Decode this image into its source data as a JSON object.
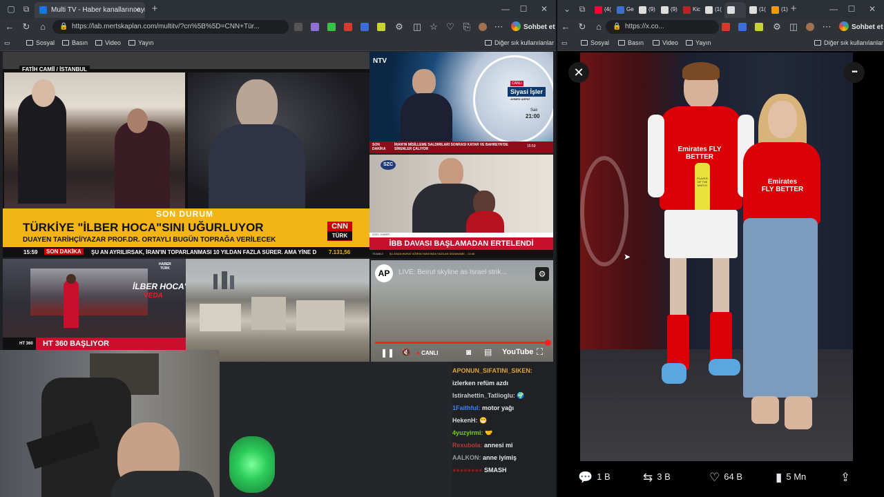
{
  "left_window": {
    "tab": {
      "title": "Multi TV - Haber kanallarını aynı a",
      "close": "✕"
    },
    "new_tab": "+",
    "controls": {
      "min": "—",
      "max": "☐",
      "close": "✕"
    },
    "url": "https://lab.mertskaplan.com/multitv/?cn%5B%5D=CNN+Tür...",
    "sohbet": "Sohbet et",
    "bookmarks": [
      "Sosyal",
      "Basın",
      "Video",
      "Yayın"
    ],
    "other_bookmarks": "Diğer sık kullanılanlar"
  },
  "tiles": {
    "cnn": {
      "location": "FATİH CAMİİ / İSTANBUL",
      "banner_tag": "SON DURUM",
      "headline": "TÜRKİYE \"İLBER HOCA\"SINI UĞURLUYOR",
      "subline": "DUAYEN TARİHÇİ/YAZAR PROF.DR. ORTAYLI BUGÜN TOPRAĞA VERİLECEK",
      "time": "15:59",
      "son_dakika": "SON DAKİKA",
      "ticker": "ŞU AN AYRILIRSAK, İRAN'IN TOPARLANMASI 10 YILDAN FAZLA SÜRER. AMA YİNE D",
      "index": "7.131,56",
      "logo_top": "CNN",
      "logo_bottom": "TÜRK"
    },
    "ntv": {
      "logo": "NTV",
      "program": "Siyasi İşler",
      "host": "AHMED ARPAT",
      "day": "Salı",
      "time": "21:00",
      "live": "CANLI",
      "son": "SON DAKİKA",
      "ticker": "İRAN'IN MİSİLLEME SALDIRILARI SONRASI KATAR VE BAHREYN'DE SİRENLER ÇALIYOR",
      "clock": "15:59"
    },
    "szc": {
      "logo": "SZC",
      "headline": "İBB DAVASI BAŞLAMADAN ERTELENDİ",
      "tag": "ÖZEL HABER",
      "ticker": "ŞU ANDA MURAT AĞIRIN HAKKINDA YAZILAN İDDİANAME... 13:45",
      "index": "73.645.2"
    },
    "haberturk": {
      "logo_top": "HABER",
      "logo_bottom": "TÜRK",
      "banner": "İLBER HOCA'YA",
      "banner2": "VEDA",
      "bottom": "HT 360 BAŞLIYOR",
      "tag": "HT 360"
    },
    "ap": {
      "logo": "AP",
      "title": "LIVE: Beirut skyline as Israel strik...",
      "live": "CANLI",
      "youtube": "YouTube",
      "progress": 1.0
    }
  },
  "chat": [
    {
      "user": "APONUN_SIFATINI_SIKEN:",
      "msg": "izlerken refüm azdı",
      "color": "#e0a23a"
    },
    {
      "user": "Istirahettin_Tatlioglu:",
      "msg": "🌍",
      "color": "#c9c9c9"
    },
    {
      "user": "1Faithful:",
      "msg": "motor yağı",
      "color": "#3b82f6"
    },
    {
      "user": "HekenH:",
      "msg": "😁",
      "color": "#d6d6d6"
    },
    {
      "user": "4yuzyirmi:",
      "msg": "🤝",
      "color": "#7ad000"
    },
    {
      "user": "Rexubola:",
      "msg": "annesi mi",
      "color": "#b33a3a"
    },
    {
      "user": "AALKON:",
      "msg": "anne iyimiş",
      "color": "#9a9a9a"
    },
    {
      "user": "●●●●●●●●",
      "msg": "SMASH",
      "color": "#8b1a1a"
    }
  ],
  "right_window": {
    "tabs": [
      "(4(",
      "Ge",
      "(9)",
      "(9)",
      "Kic",
      "(1(",
      "",
      "(1(",
      "(1)"
    ],
    "new_tab": "+",
    "controls": {
      "min": "—",
      "max": "☐",
      "close": "✕"
    },
    "url": "https://x.co...",
    "sohbet": "Sohbet et",
    "bookmarks": [
      "Sosyal",
      "Basın",
      "Video",
      "Yayın"
    ],
    "other_bookmarks": "Diğer sık kullanılanlar",
    "close_icon": "✕",
    "more_icon": "•••",
    "actions": {
      "replies": "1 B",
      "reposts": "3 B",
      "likes": "64 B",
      "views": "5 Mn"
    }
  },
  "photo": {
    "shirt_text": "Emirates FLY BETTER",
    "trophy_label": "PLAYER OF THE MATCH"
  }
}
